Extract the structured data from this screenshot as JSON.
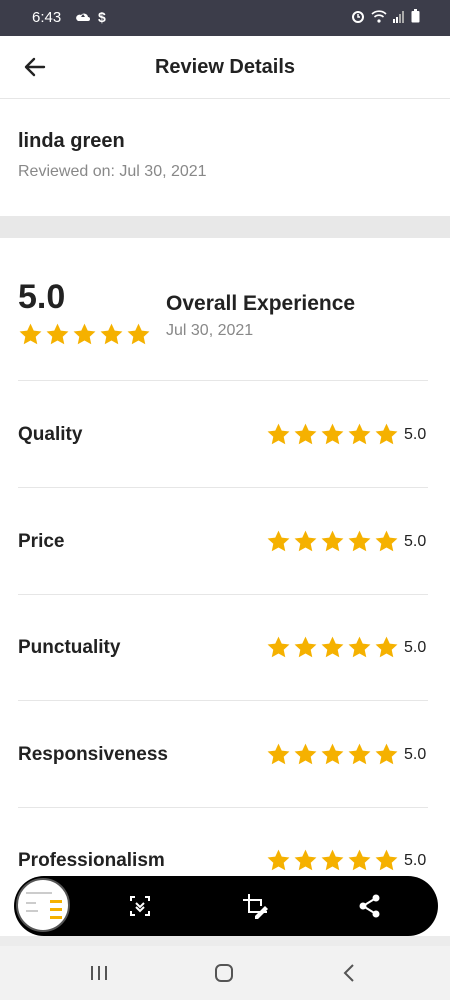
{
  "status_bar": {
    "time": "6:43",
    "left_icons": [
      "cloud-upload-icon",
      "dollar-icon"
    ],
    "right_icons": [
      "alarm-icon",
      "wifi-icon",
      "signal-icon",
      "battery-icon"
    ],
    "dollar_glyph": "$"
  },
  "header": {
    "title": "Review Details",
    "back_icon": "back-arrow-icon"
  },
  "reviewer": {
    "name": "linda green",
    "reviewed_on": "Reviewed on: Jul 30, 2021"
  },
  "overall": {
    "score": "5.0",
    "rating": 5,
    "title": "Overall Experience",
    "date": "Jul 30, 2021"
  },
  "categories": [
    {
      "label": "Quality",
      "score": "5.0",
      "rating": 5
    },
    {
      "label": "Price",
      "score": "5.0",
      "rating": 5
    },
    {
      "label": "Punctuality",
      "score": "5.0",
      "rating": 5
    },
    {
      "label": "Responsiveness",
      "score": "5.0",
      "rating": 5
    },
    {
      "label": "Professionalism",
      "score": "5.0",
      "rating": 5
    }
  ],
  "screenshot_toolbar": {
    "buttons": [
      "screenshot-thumbnail",
      "scroll-capture-icon",
      "crop-edit-icon",
      "share-icon"
    ]
  },
  "nav_bar": {
    "buttons": [
      "recent-apps-icon",
      "home-icon",
      "back-icon"
    ]
  },
  "colors": {
    "star": "#f5b100",
    "status_bar_bg": "#3c3d4a",
    "divider_band": "#e8e8e8",
    "toolbar_bg": "#000000"
  }
}
